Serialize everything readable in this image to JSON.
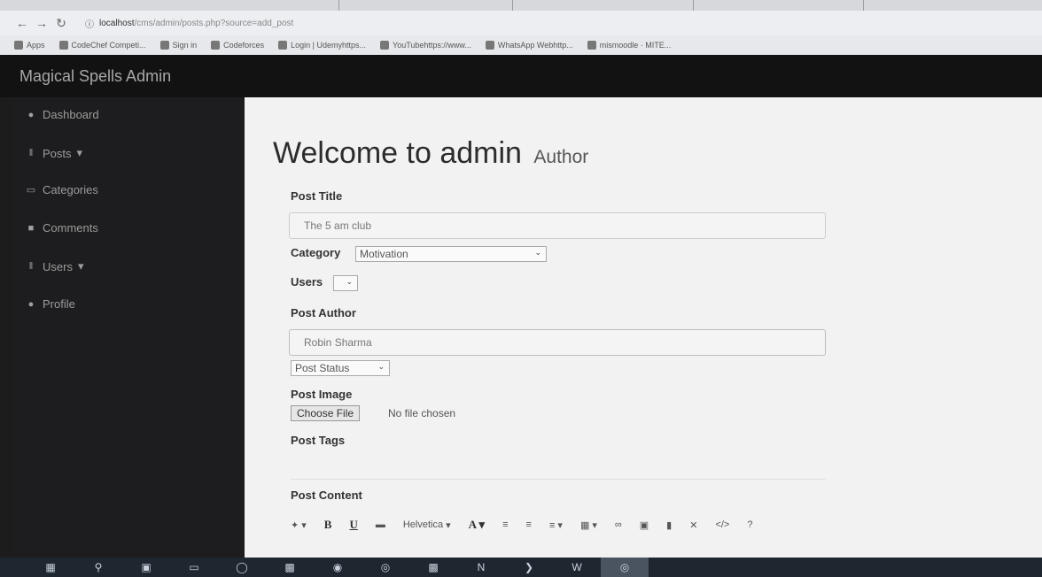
{
  "browser": {
    "url_host": "localhost",
    "url_path": "/cms/admin/posts.php?source=add_post",
    "bookmarks": [
      "Apps",
      "CodeChef Competi...",
      "Sign in",
      "Codeforces",
      "Login | Udemyhttps...",
      "YouTubehttps://www...",
      "WhatsApp Webhttp...",
      "mismoodle · MITE..."
    ]
  },
  "app": {
    "brand": "Magical Spells Admin"
  },
  "sidebar": {
    "items": [
      {
        "label": "Dashboard",
        "icon": "dashboard-icon"
      },
      {
        "label": "Posts",
        "icon": "posts-icon",
        "caret": "▾"
      },
      {
        "label": "Categories",
        "icon": "categories-icon"
      },
      {
        "label": "Comments",
        "icon": "comments-icon"
      },
      {
        "label": "Users",
        "icon": "users-icon",
        "caret": "▾"
      },
      {
        "label": "Profile",
        "icon": "profile-icon"
      }
    ]
  },
  "main": {
    "heading": "Welcome to admin",
    "heading_sub": "Author",
    "post_title_label": "Post Title",
    "post_title_value": "The 5 am club",
    "category_label": "Category",
    "category_value": "Motivation",
    "users_label": "Users",
    "post_author_label": "Post Author",
    "post_author_value": "Robin Sharma",
    "post_status_value": "Post Status",
    "post_image_label": "Post Image",
    "choose_file_label": "Choose File",
    "no_file_text": "No file chosen",
    "post_tags_label": "Post Tags",
    "post_content_label": "Post Content",
    "editor": {
      "font_name": "Helvetica"
    }
  }
}
